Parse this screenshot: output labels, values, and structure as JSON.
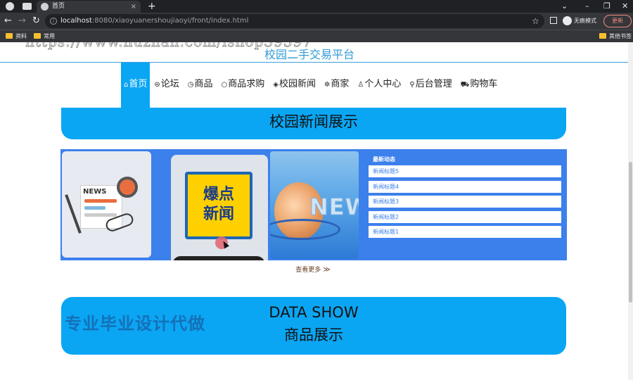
{
  "browser": {
    "tab_title": "首页",
    "tab_close": "×",
    "new_tab": "+",
    "url_host": "localhost",
    "url_rest": ":8080/xiaoyuanershoujiaoyi/front/index.html",
    "incognito_label": "无痕模式",
    "update_label": "更新",
    "window_controls": {
      "chevron": "⌄",
      "minimize": "–",
      "restore": "❐",
      "close": "✕"
    },
    "nav": {
      "back": "←",
      "forward": "→",
      "reload": "↻"
    },
    "star": "☆",
    "bookmarks": [
      {
        "label": "资料"
      },
      {
        "label": "常用"
      }
    ],
    "other_bookmarks": "其他书签"
  },
  "watermark": "https://www.huzhan.com/ishop39397",
  "site": {
    "title": "校园二手交易平台"
  },
  "menu": [
    {
      "icon": "⌂",
      "label": "首页",
      "active": true
    },
    {
      "icon": "⊜",
      "label": "论坛"
    },
    {
      "icon": "◷",
      "label": "商品"
    },
    {
      "icon": "○",
      "label": "商品求购"
    },
    {
      "icon": "◈",
      "label": "校园新闻"
    },
    {
      "icon": "✲",
      "label": "商家"
    },
    {
      "icon": "♙",
      "label": "个人中心"
    },
    {
      "icon": "⚲",
      "label": "后台管理"
    },
    {
      "icon": "⛟",
      "label": "购物车"
    }
  ],
  "news_section": {
    "heading": "校园新闻展示",
    "newspaper_label": "NEWS",
    "breaking_line1": "爆点",
    "breaking_line2": "新闻",
    "card3_text": "NEW",
    "latest_title": "最新动态",
    "items": [
      "新闻标题5",
      "新闻标题4",
      "新闻标题3",
      "新闻标题2",
      "新闻标题1"
    ],
    "more": "查看更多",
    "more_chevron": "≫"
  },
  "goods_section": {
    "overlay": "专业毕业设计代做",
    "heading_en": "DATA SHOW",
    "heading_zh": "商品展示"
  },
  "colors": {
    "accent": "#0aa6f3",
    "panel": "#3c80ec",
    "title": "#2f9bd7"
  }
}
